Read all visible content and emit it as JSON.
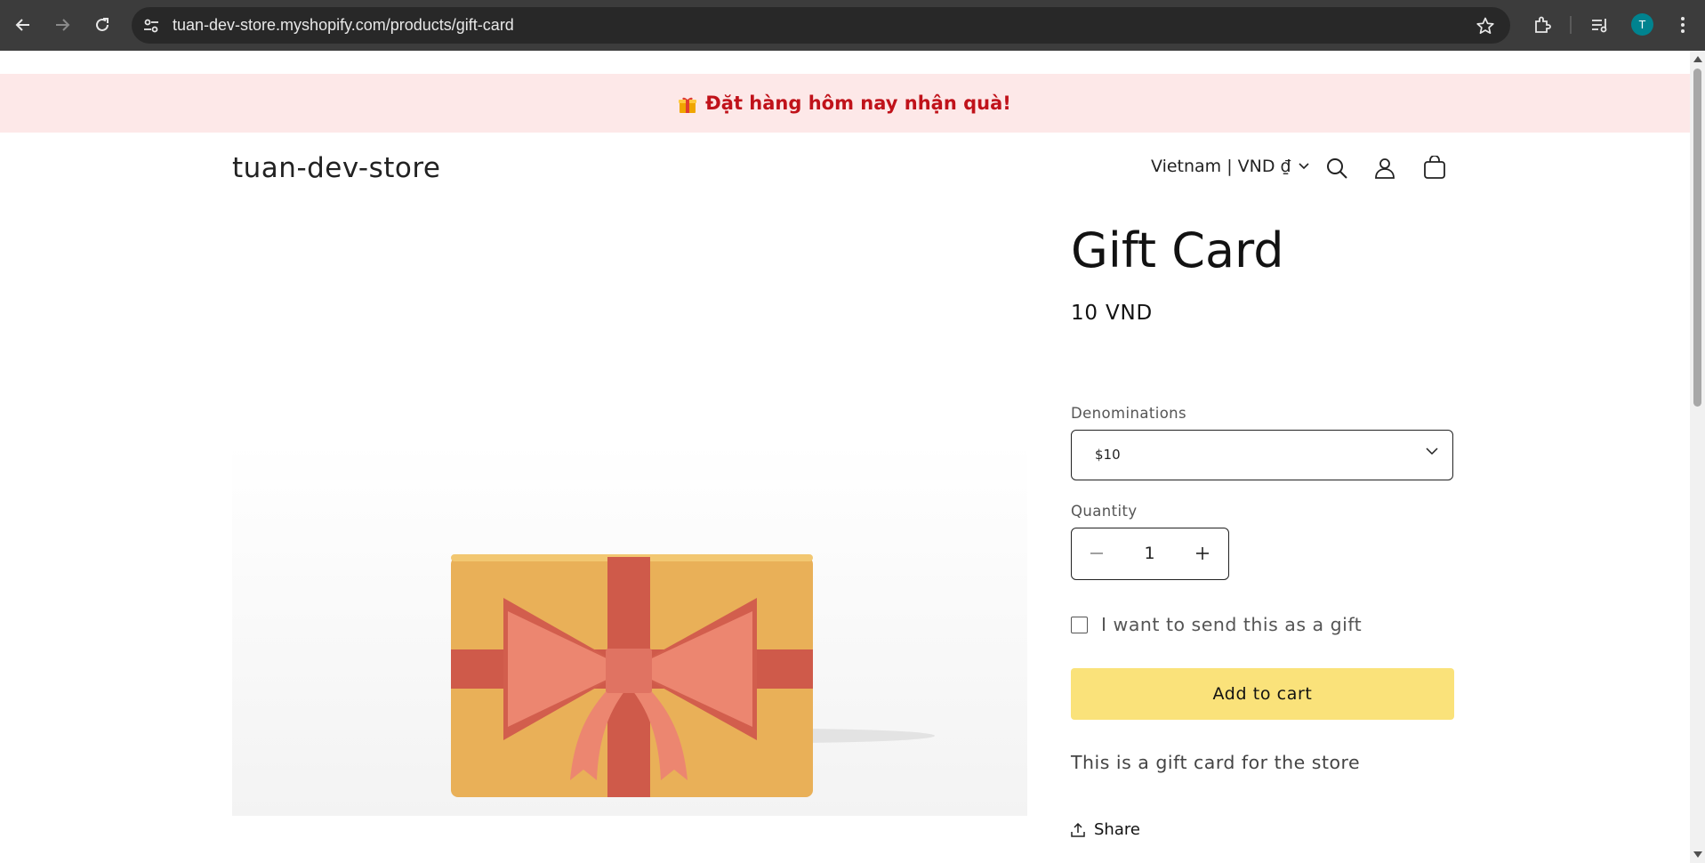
{
  "browser": {
    "url": "tuan-dev-store.myshopify.com/products/gift-card",
    "avatar_letter": "T",
    "icons": [
      "back-icon",
      "forward-icon",
      "reload-icon",
      "site-settings-icon",
      "bookmark-star-icon",
      "extensions-icon",
      "media-control-icon",
      "kebab-menu-icon"
    ]
  },
  "announcement": {
    "text": "Đặt hàng hôm nay nhận quà!",
    "color": "#c0121a",
    "background": "#fde8e8"
  },
  "header": {
    "logo": "tuan-dev-store",
    "country_selector": "Vietnam | VND ₫",
    "icons": [
      "search-icon",
      "account-icon",
      "cart-icon"
    ]
  },
  "product": {
    "title": "Gift Card",
    "price": "10 VND",
    "denominations_label": "Denominations",
    "denomination_selected": "$10",
    "quantity_label": "Quantity",
    "quantity_value": "1",
    "gift_checkbox_label": "I want to send this as a gift",
    "add_to_cart_label": "Add to cart",
    "add_to_cart_color": "#fae27a",
    "description": "This is a gift card for the store",
    "share_label": "Share"
  }
}
